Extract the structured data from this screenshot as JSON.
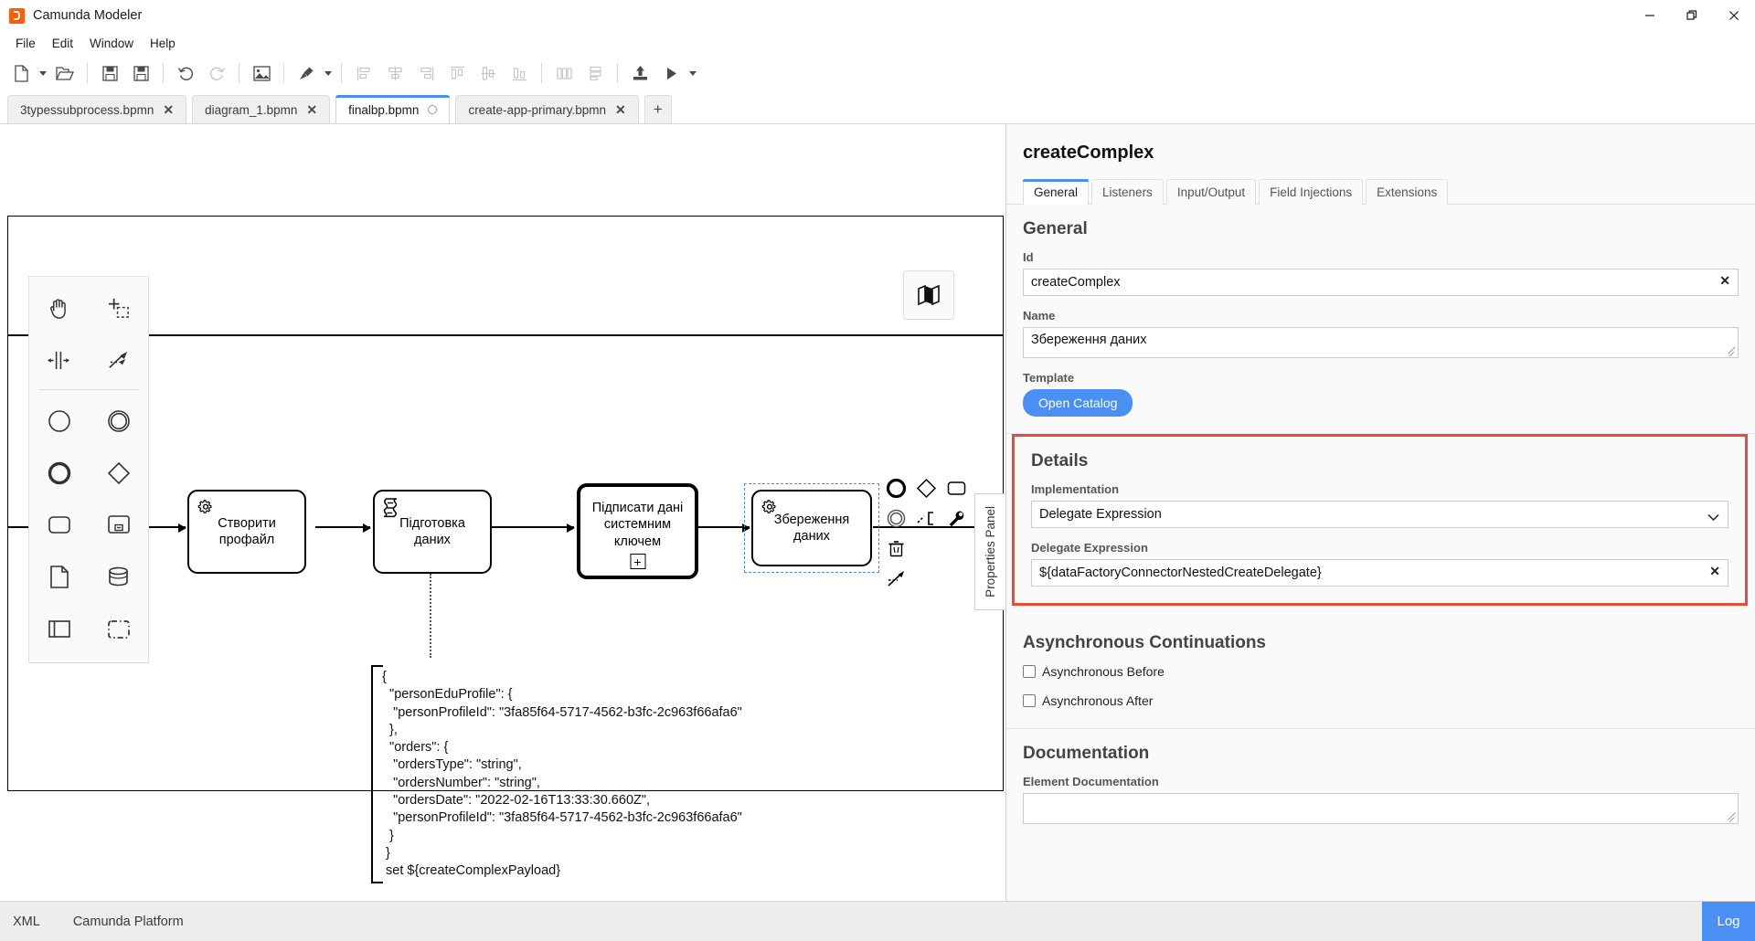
{
  "window": {
    "title": "Camunda Modeler",
    "logo_icon": "camunda-logo-icon",
    "minimize_label": "–",
    "maximize_label": "❐",
    "close_label": "✕"
  },
  "menu": {
    "items": [
      "File",
      "Edit",
      "Window",
      "Help"
    ]
  },
  "toolbar": {
    "groups": [
      {
        "buttons": [
          {
            "name": "new-file-button",
            "icon": "new-file-icon",
            "dropdown": true,
            "disabled": false
          },
          {
            "name": "open-file-button",
            "icon": "open-folder-icon",
            "dropdown": false,
            "disabled": false
          }
        ]
      },
      {
        "buttons": [
          {
            "name": "save-button",
            "icon": "save-icon",
            "dropdown": false,
            "disabled": false
          },
          {
            "name": "save-as-button",
            "icon": "save-as-icon",
            "dropdown": false,
            "disabled": false
          }
        ]
      },
      {
        "buttons": [
          {
            "name": "undo-button",
            "icon": "undo-icon",
            "dropdown": false,
            "disabled": false
          },
          {
            "name": "redo-button",
            "icon": "redo-icon",
            "dropdown": false,
            "disabled": true
          }
        ]
      },
      {
        "buttons": [
          {
            "name": "export-image-button",
            "icon": "image-export-icon",
            "dropdown": false,
            "disabled": false
          }
        ]
      },
      {
        "buttons": [
          {
            "name": "align-tool-button",
            "icon": "paintbrush-icon",
            "dropdown": true,
            "disabled": false
          }
        ]
      },
      {
        "buttons": [
          {
            "name": "align-left-button",
            "icon": "align-left-icon",
            "dropdown": false,
            "disabled": true
          },
          {
            "name": "align-center-button",
            "icon": "align-center-icon",
            "dropdown": false,
            "disabled": true
          },
          {
            "name": "align-right-button",
            "icon": "align-right-icon",
            "dropdown": false,
            "disabled": true
          },
          {
            "name": "align-top-button",
            "icon": "align-top-icon",
            "dropdown": false,
            "disabled": true
          },
          {
            "name": "align-middle-button",
            "icon": "align-middle-icon",
            "dropdown": false,
            "disabled": true
          },
          {
            "name": "align-bottom-button",
            "icon": "align-bottom-icon",
            "dropdown": false,
            "disabled": true
          }
        ]
      },
      {
        "buttons": [
          {
            "name": "distribute-horizontal-button",
            "icon": "distribute-horizontal-icon",
            "dropdown": false,
            "disabled": true
          },
          {
            "name": "distribute-vertical-button",
            "icon": "distribute-vertical-icon",
            "dropdown": false,
            "disabled": true
          }
        ]
      },
      {
        "buttons": [
          {
            "name": "deploy-button",
            "icon": "deploy-upload-icon",
            "dropdown": false,
            "disabled": false
          },
          {
            "name": "run-button",
            "icon": "play-icon",
            "dropdown": true,
            "disabled": false
          }
        ]
      }
    ]
  },
  "tabs": {
    "items": [
      {
        "label": "3typessubprocess.bpmn",
        "active": false,
        "dirty": false,
        "close_label": "✕"
      },
      {
        "label": "diagram_1.bpmn",
        "active": false,
        "dirty": false,
        "close_label": "✕"
      },
      {
        "label": "finalbp.bpmn",
        "active": true,
        "dirty": true,
        "close_label": "✕"
      },
      {
        "label": "create-app-primary.bpmn",
        "active": false,
        "dirty": false,
        "close_label": "✕"
      }
    ],
    "add_label": "+"
  },
  "palette": {
    "tools": [
      {
        "name": "hand-tool",
        "icon": "hand-icon"
      },
      {
        "name": "lasso-tool",
        "icon": "lasso-select-icon"
      },
      {
        "name": "space-tool",
        "icon": "space-tool-icon"
      },
      {
        "name": "connect-tool",
        "icon": "connect-arrows-icon"
      }
    ],
    "elements": [
      {
        "name": "create-start-event",
        "icon": "start-event-circle-icon"
      },
      {
        "name": "create-intermediate-event",
        "icon": "intermediate-event-double-circle-icon"
      },
      {
        "name": "create-end-event",
        "icon": "end-event-thick-circle-icon"
      },
      {
        "name": "create-gateway",
        "icon": "gateway-diamond-icon"
      },
      {
        "name": "create-task",
        "icon": "task-rounded-rect-icon"
      },
      {
        "name": "create-subprocess-collapsed",
        "icon": "subprocess-collapsed-icon"
      },
      {
        "name": "create-data-object",
        "icon": "data-object-page-icon"
      },
      {
        "name": "create-data-store",
        "icon": "data-store-cylinder-icon"
      },
      {
        "name": "create-participant",
        "icon": "participant-pool-icon"
      },
      {
        "name": "create-group",
        "icon": "group-dashed-icon"
      }
    ]
  },
  "diagram": {
    "tasks": [
      {
        "id": "task-create-profile",
        "label": "Створити\nпрофайл",
        "icon": "service-task-gear-icon",
        "thick": false,
        "subprocess": false,
        "selected": false
      },
      {
        "id": "task-prepare-data",
        "label": "Підготовка\nданих",
        "icon": "script-task-icon",
        "thick": false,
        "subprocess": false,
        "selected": false
      },
      {
        "id": "task-sign-data",
        "label": "Підписати дані\nсистемним\nключем",
        "icon": "",
        "thick": true,
        "subprocess": true,
        "selected": false
      },
      {
        "id": "task-save-data",
        "label": "Збереження\nданих",
        "icon": "service-task-gear-icon",
        "thick": false,
        "subprocess": false,
        "selected": true
      }
    ],
    "annotation": "{\n  \"personEduProfile\": {\n   \"personProfileId\": \"3fa85f64-5717-4562-b3fc-2c963f66afa6\"\n  },\n  \"orders\": {\n   \"ordersType\": \"string\",\n   \"ordersNumber\": \"string\",\n   \"ordersDate\": \"2022-02-16T13:33:30.660Z\",\n   \"personProfileId\": \"3fa85f64-5717-4562-b3fc-2c963f66afa6\"\n  }\n }\n set ${createComplexPayload}",
    "context_pad": [
      {
        "name": "append-end-event",
        "icon": "end-event-thick-circle-icon"
      },
      {
        "name": "append-gateway",
        "icon": "gateway-diamond-icon"
      },
      {
        "name": "append-task",
        "icon": "task-rounded-rect-icon"
      },
      {
        "name": "append-intermediate-event",
        "icon": "intermediate-event-double-circle-icon"
      },
      {
        "name": "append-text-annotation",
        "icon": "text-annotation-icon"
      },
      {
        "name": "change-element-type",
        "icon": "wrench-icon"
      },
      {
        "name": "delete-element",
        "icon": "trash-icon"
      },
      {
        "name": "connect-element",
        "icon": "connect-arrows-icon"
      }
    ],
    "minimap_icon": "map-icon",
    "properties_panel_handle": "Properties Panel"
  },
  "properties": {
    "title": "createComplex",
    "tabs": [
      {
        "label": "General",
        "active": true
      },
      {
        "label": "Listeners",
        "active": false
      },
      {
        "label": "Input/Output",
        "active": false
      },
      {
        "label": "Field Injections",
        "active": false
      },
      {
        "label": "Extensions",
        "active": false
      }
    ],
    "general": {
      "heading": "General",
      "id_label": "Id",
      "id_value": "createComplex",
      "id_clear": "✕",
      "name_label": "Name",
      "name_value": "Збереження даних",
      "template_label": "Template",
      "open_catalog_label": "Open Catalog"
    },
    "details": {
      "heading": "Details",
      "implementation_label": "Implementation",
      "implementation_value": "Delegate Expression",
      "implementation_options": [
        "Delegate Expression"
      ],
      "delegate_expression_label": "Delegate Expression",
      "delegate_expression_value": "${dataFactoryConnectorNestedCreateDelegate}",
      "delegate_clear": "✕",
      "highlight_color": "#ea4c3b"
    },
    "async": {
      "heading": "Asynchronous Continuations",
      "before_label": "Asynchronous Before",
      "before_checked": false,
      "after_label": "Asynchronous After",
      "after_checked": false
    },
    "documentation": {
      "heading": "Documentation",
      "element_doc_label": "Element Documentation",
      "element_doc_value": ""
    }
  },
  "statusbar": {
    "xml_label": "XML",
    "platform_label": "Camunda Platform",
    "log_label": "Log",
    "log_color": "#4a90f4"
  }
}
